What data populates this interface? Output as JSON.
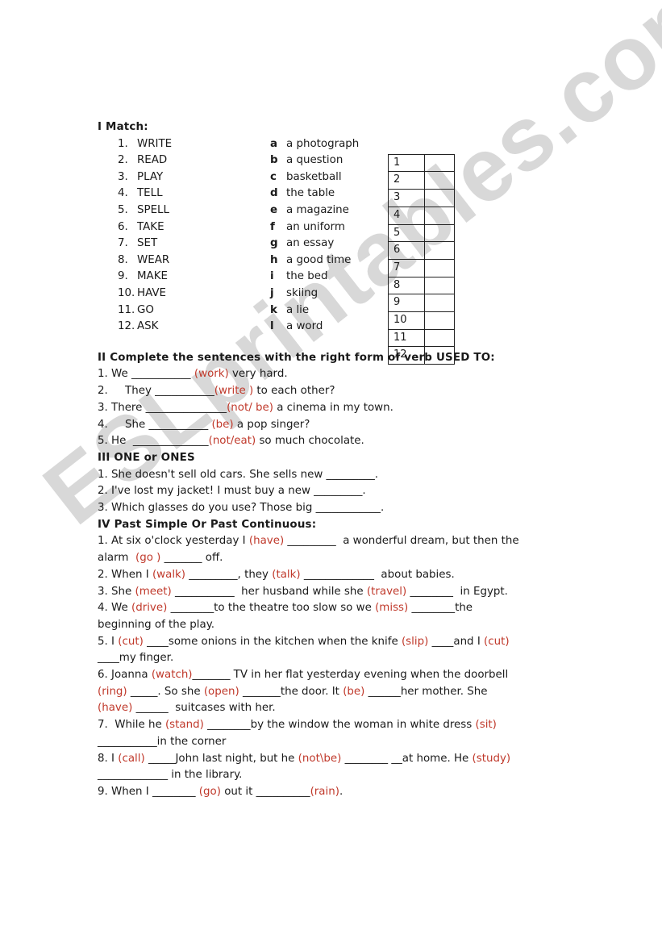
{
  "watermark": "ESLprintables.com",
  "colors": {
    "cue": "#c0392b",
    "text": "#1a1a1a",
    "watermark": "#d2d2d2"
  },
  "section1": {
    "title": "I Match:",
    "verbs": [
      {
        "num": "1.",
        "word": "WRITE"
      },
      {
        "num": "2.",
        "word": "READ"
      },
      {
        "num": "3.",
        "word": "PLAY"
      },
      {
        "num": "4.",
        "word": "TELL"
      },
      {
        "num": "5.",
        "word": "SPELL"
      },
      {
        "num": "6.",
        "word": "TAKE"
      },
      {
        "num": "7.",
        "word": "SET"
      },
      {
        "num": "8.",
        "word": "WEAR"
      },
      {
        "num": "9.",
        "word": "MAKE"
      },
      {
        "num": "10.",
        "word": "HAVE"
      },
      {
        "num": "11.",
        "word": "GO"
      },
      {
        "num": "12.",
        "word": "ASK"
      }
    ],
    "phrases": [
      {
        "letter": "a",
        "text": "a photograph"
      },
      {
        "letter": "b",
        "text": "a question"
      },
      {
        "letter": "c",
        "text": "basketball"
      },
      {
        "letter": "d",
        "text": "the table"
      },
      {
        "letter": "e",
        "text": "a magazine"
      },
      {
        "letter": "f",
        "text": "an uniform"
      },
      {
        "letter": "g",
        "text": "an essay"
      },
      {
        "letter": "h",
        "text": "a good time"
      },
      {
        "letter": "i",
        "text": "the bed"
      },
      {
        "letter": "j",
        "text": "skiing"
      },
      {
        "letter": "k",
        "text": "a lie"
      },
      {
        "letter": "l",
        "text": "a word"
      }
    ],
    "answer_rows": [
      "1",
      "2",
      "3",
      "4",
      "5",
      "6",
      "7",
      "8",
      "9",
      "10",
      "11",
      "12"
    ]
  },
  "section2": {
    "title": "II Complete the sentences with the right form of verb USED TO:",
    "lines": [
      [
        {
          "t": "1. We ___________ "
        },
        {
          "c": "(work)"
        },
        {
          "t": " very hard."
        }
      ],
      [
        {
          "t": "2.     They ___________"
        },
        {
          "c": "(write )"
        },
        {
          "t": " to each other?"
        }
      ],
      [
        {
          "t": "3. There _______________"
        },
        {
          "c": "(not/ be)"
        },
        {
          "t": " a cinema in my town."
        }
      ],
      [
        {
          "t": "4.     She ___________ "
        },
        {
          "c": "(be)"
        },
        {
          "t": " a pop singer?"
        }
      ],
      [
        {
          "t": "5. He  ______________"
        },
        {
          "c": "(not/eat)"
        },
        {
          "t": " so much chocolate."
        }
      ]
    ]
  },
  "section3": {
    "title": "III ONE or ONES",
    "lines": [
      [
        {
          "t": "1. She doesn't sell old cars. She sells new _________."
        }
      ],
      [
        {
          "t": "2. I've lost my jacket! I must buy a new _________."
        }
      ],
      [
        {
          "t": "3. Which glasses do you use? Those big ____________."
        }
      ]
    ]
  },
  "section4": {
    "title": "IV Past Simple Or Past Continuous:",
    "lines": [
      [
        {
          "t": "1. At six o'clock yesterday I "
        },
        {
          "c": "(have)"
        },
        {
          "t": " _________  a wonderful dream, but then the"
        }
      ],
      [
        {
          "t": "alarm  "
        },
        {
          "c": "(go )"
        },
        {
          "t": " _______ off."
        }
      ],
      [
        {
          "t": "2. When I "
        },
        {
          "c": "(walk)"
        },
        {
          "t": " _________, they "
        },
        {
          "c": "(talk)"
        },
        {
          "t": " _____________  about babies."
        }
      ],
      [
        {
          "t": "3. She "
        },
        {
          "c": "(meet)"
        },
        {
          "t": " ___________  her husband while she "
        },
        {
          "c": "(travel)"
        },
        {
          "t": " ________  in Egypt."
        }
      ],
      [
        {
          "t": "4. We "
        },
        {
          "c": "(drive)"
        },
        {
          "t": " ________to the theatre too slow so we "
        },
        {
          "c": "(miss)"
        },
        {
          "t": " ________the"
        }
      ],
      [
        {
          "t": "beginning of the play."
        }
      ],
      [
        {
          "t": "5. I "
        },
        {
          "c": "(cut)"
        },
        {
          "t": " ____some onions in the kitchen when the knife "
        },
        {
          "c": "(slip)"
        },
        {
          "t": " ____and I "
        },
        {
          "c": "(cut)"
        }
      ],
      [
        {
          "t": "____my finger."
        }
      ],
      [
        {
          "t": "6. Joanna "
        },
        {
          "c": "(watch)"
        },
        {
          "t": "_______ TV in her flat yesterday evening when the doorbell"
        }
      ],
      [
        {
          "c": "(ring)"
        },
        {
          "t": " _____. So she "
        },
        {
          "c": "(open)"
        },
        {
          "t": " _______the door. It "
        },
        {
          "c": "(be)"
        },
        {
          "t": " ______her mother. She"
        }
      ],
      [
        {
          "c": "(have)"
        },
        {
          "t": " ______  suitcases with her."
        }
      ],
      [
        {
          "t": "7.  While he "
        },
        {
          "c": "(stand)"
        },
        {
          "t": " ________by the window the woman in white dress "
        },
        {
          "c": "(sit)"
        }
      ],
      [
        {
          "t": "___________in the corner"
        }
      ],
      [
        {
          "t": "8. I "
        },
        {
          "c": "(call)"
        },
        {
          "t": " _____John last night, but he "
        },
        {
          "c": "(not\\be)"
        },
        {
          "t": " ________ __at home. He "
        },
        {
          "c": "(study)"
        }
      ],
      [
        {
          "t": "_____________ in the library."
        }
      ],
      [
        {
          "t": "9. When I ________ "
        },
        {
          "c": "(go)"
        },
        {
          "t": " out it __________"
        },
        {
          "c": "(rain)"
        },
        {
          "t": "."
        }
      ]
    ]
  }
}
